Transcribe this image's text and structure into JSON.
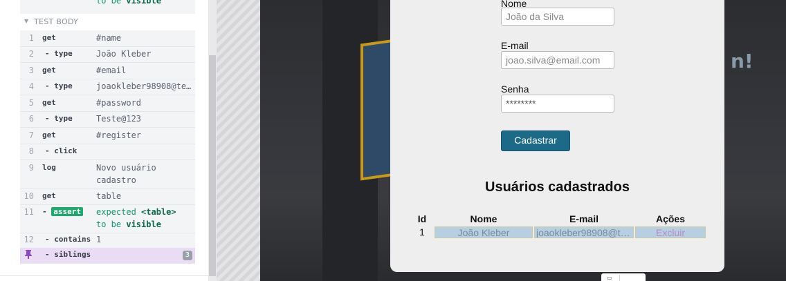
{
  "command_log": {
    "prev_block_text": "to be",
    "prev_block_value": "visible",
    "section_title": "TEST BODY",
    "commands": [
      {
        "num": "1",
        "name": "get",
        "message": "#name"
      },
      {
        "num": "2",
        "name": "- type",
        "message": "João Kleber"
      },
      {
        "num": "3",
        "name": "get",
        "message": "#email"
      },
      {
        "num": "4",
        "name": "- type",
        "message": "joaokleber98908@te…"
      },
      {
        "num": "5",
        "name": "get",
        "message": "#password"
      },
      {
        "num": "6",
        "name": "- type",
        "message": "Teste@123"
      },
      {
        "num": "7",
        "name": "get",
        "message": "#register"
      },
      {
        "num": "8",
        "name": "- click",
        "message": ""
      },
      {
        "num": "9",
        "name": "log",
        "message": "Novo usuário cadastro"
      },
      {
        "num": "10",
        "name": "get",
        "message": "table"
      },
      {
        "num": "11",
        "name": "assert",
        "message_prefix": "expected",
        "message_tag": "<table>",
        "message_mid": "to be",
        "message_value": "visible"
      },
      {
        "num": "12",
        "name": "- contains",
        "message": "1"
      },
      {
        "num": "",
        "name": "- siblings",
        "message": "",
        "badge": "3"
      }
    ]
  },
  "form": {
    "name_label": "Nome",
    "name_placeholder": "João da Silva",
    "email_label": "E-mail",
    "email_placeholder": "joao.silva@email.com",
    "password_label": "Senha",
    "password_value": "********",
    "register_button": "Cadastrar"
  },
  "users": {
    "title": "Usuários cadastrados",
    "headers": [
      "Id",
      "Nome",
      "E-mail",
      "Ações"
    ],
    "rows": [
      {
        "id": "1",
        "name": "João Kleber",
        "email": "joaokleber98908@t…",
        "action": "Excluir"
      }
    ]
  },
  "colors": {
    "register_button_bg": "#1c6a87",
    "assert_badge": "#1fa971",
    "pinned_row": "#eadcf5",
    "highlight_cell": "#b7cfe3"
  },
  "icons": [
    "pin-icon",
    "collapse-triangle-icon"
  ]
}
